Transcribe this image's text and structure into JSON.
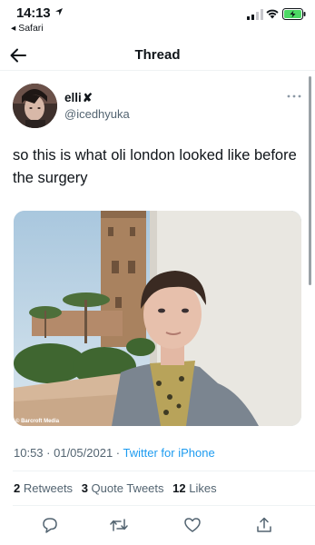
{
  "status_bar": {
    "time": "14:13",
    "back_app": "◂ Safari",
    "battery_color": "#4cd964"
  },
  "nav": {
    "title": "Thread",
    "back_icon": "arrow-left-icon"
  },
  "tweet": {
    "display_name": "elli",
    "name_badge": "✘",
    "handle": "@icedhyuka",
    "text": "so this is what oli london looked like before the surgery",
    "media_credit": "© Barcroft Media",
    "time": "10:53",
    "separator": " · ",
    "date": "01/05/2021",
    "source": "Twitter for iPhone",
    "stats": {
      "retweets_count": "2",
      "retweets_label": "Retweets",
      "quotes_count": "3",
      "quotes_label": "Quote Tweets",
      "likes_count": "12",
      "likes_label": "Likes"
    }
  },
  "actions": [
    "reply-icon",
    "retweet-icon",
    "like-icon",
    "share-icon"
  ],
  "colors": {
    "accent": "#1d9bf0",
    "secondary_text": "#536471",
    "divider": "#eff3f4"
  }
}
